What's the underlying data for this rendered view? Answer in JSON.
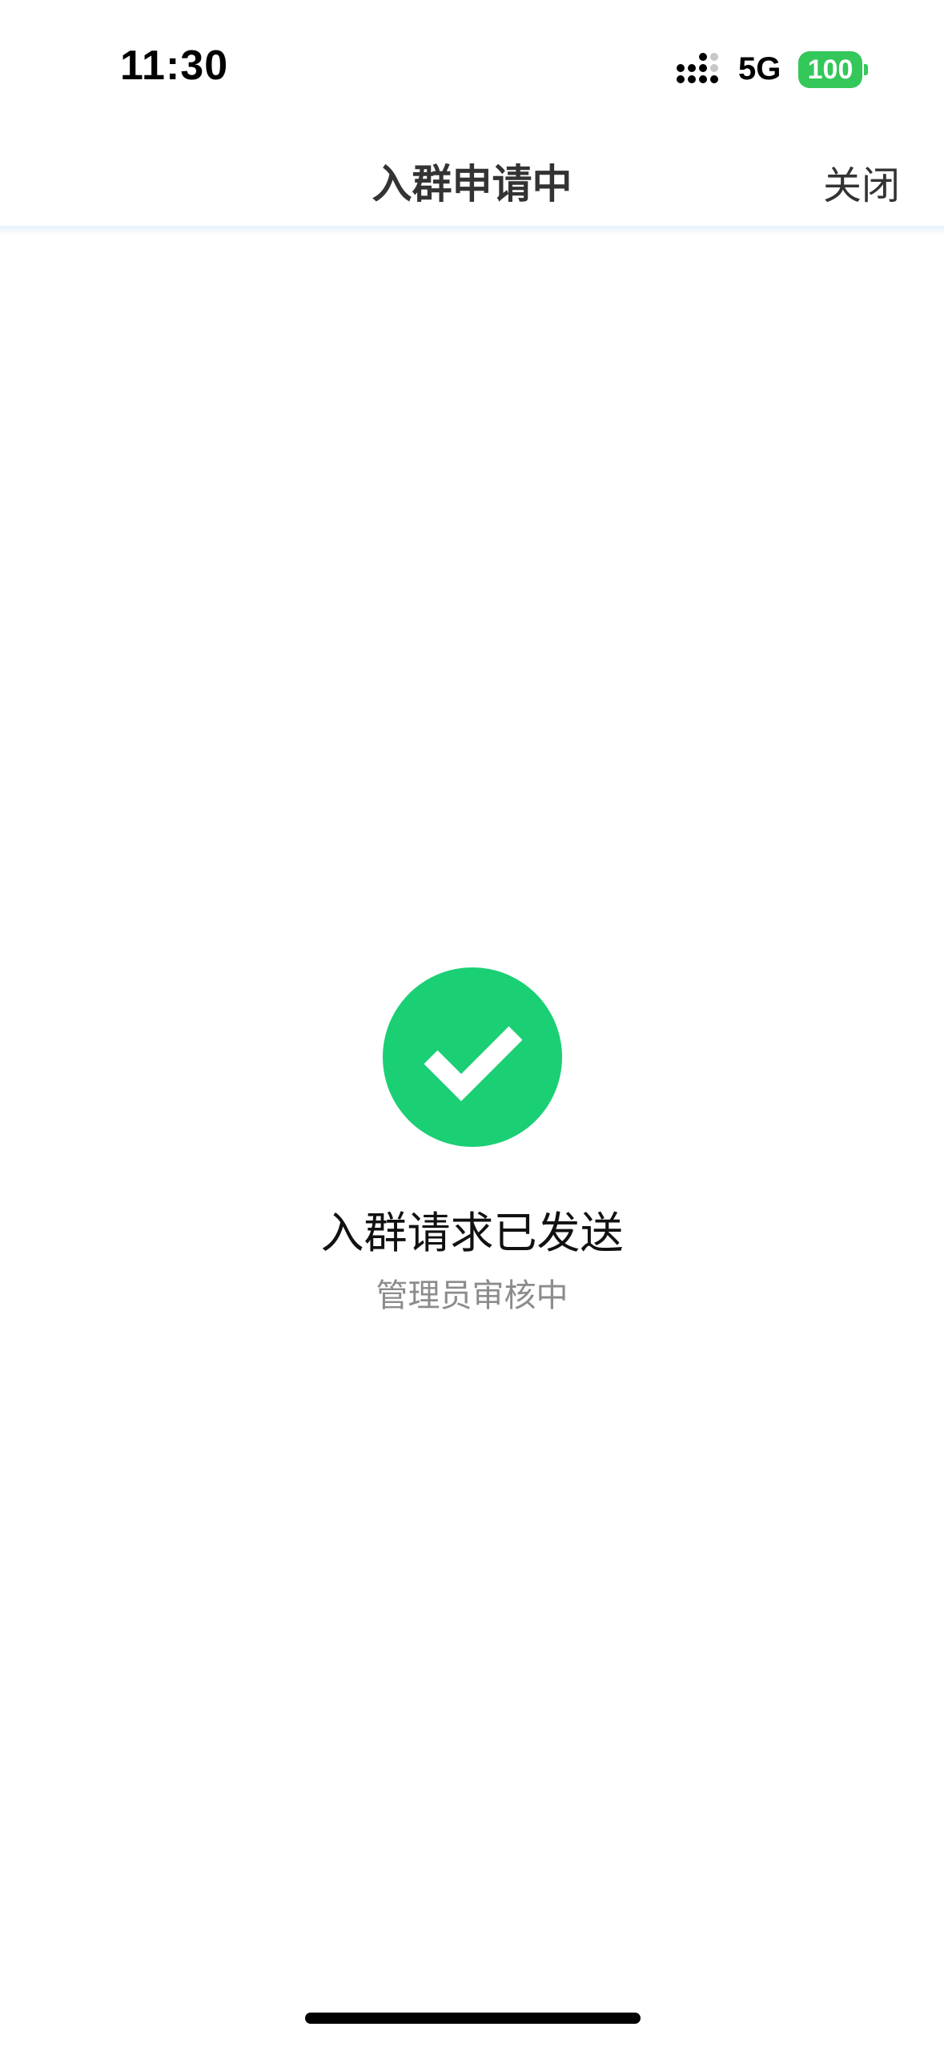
{
  "status_bar": {
    "time": "11:30",
    "network": "5G",
    "battery": "100",
    "battery_color": "#34c759"
  },
  "nav": {
    "title": "入群申请中",
    "close_label": "关闭"
  },
  "result": {
    "icon": "check-circle-icon",
    "icon_color": "#1bcf74",
    "title": "入群请求已发送",
    "subtitle": "管理员审核中"
  }
}
